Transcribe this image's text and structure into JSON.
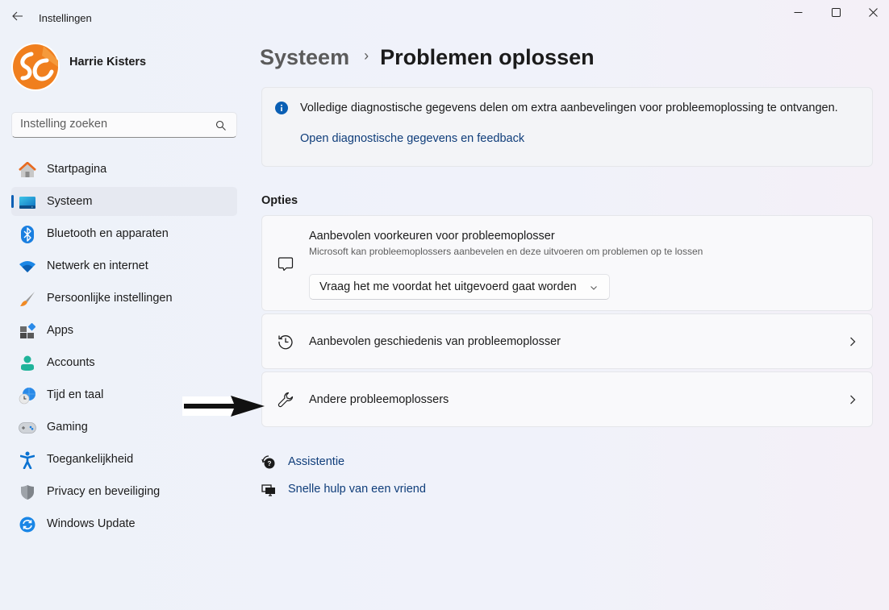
{
  "window": {
    "title": "Instellingen",
    "controls": {
      "minimize": "minimize",
      "maximize": "maximize",
      "close": "close"
    }
  },
  "profile": {
    "name": "Harrie Kisters"
  },
  "search": {
    "placeholder": "Instelling zoeken",
    "value": ""
  },
  "sidebar": {
    "items": [
      {
        "label": "Startpagina",
        "icon": "home-icon",
        "active": false
      },
      {
        "label": "Systeem",
        "icon": "system-icon",
        "active": true
      },
      {
        "label": "Bluetooth en apparaten",
        "icon": "bluetooth-icon",
        "active": false
      },
      {
        "label": "Netwerk en internet",
        "icon": "wifi-icon",
        "active": false
      },
      {
        "label": "Persoonlijke instellingen",
        "icon": "brush-icon",
        "active": false
      },
      {
        "label": "Apps",
        "icon": "apps-icon",
        "active": false
      },
      {
        "label": "Accounts",
        "icon": "account-icon",
        "active": false
      },
      {
        "label": "Tijd en taal",
        "icon": "time-language-icon",
        "active": false
      },
      {
        "label": "Gaming",
        "icon": "gamepad-icon",
        "active": false
      },
      {
        "label": "Toegankelijkheid",
        "icon": "accessibility-icon",
        "active": false
      },
      {
        "label": "Privacy en beveiliging",
        "icon": "shield-icon",
        "active": false
      },
      {
        "label": "Windows Update",
        "icon": "update-icon",
        "active": false
      }
    ]
  },
  "header": {
    "breadcrumb_parent": "Systeem",
    "breadcrumb_separator": "›",
    "title": "Problemen oplossen"
  },
  "info": {
    "text": "Volledige diagnostische gegevens delen om extra aanbevelingen voor probleemoplossing te ontvangen.",
    "link": "Open diagnostische gegevens en feedback"
  },
  "options": {
    "section_title": "Opties",
    "preferences": {
      "title": "Aanbevolen voorkeuren voor probleemoplosser",
      "description": "Microsoft kan probleemoplossers aanbevelen en deze uitvoeren om problemen op te lossen",
      "dropdown_value": "Vraag het me voordat het uitgevoerd gaat worden"
    },
    "history": {
      "title": "Aanbevolen geschiedenis van probleemoplosser"
    },
    "other": {
      "title": "Andere probleemoplossers"
    }
  },
  "help": {
    "links": [
      {
        "label": "Assistentie",
        "icon": "help-chat-icon"
      },
      {
        "label": "Snelle hulp van een vriend",
        "icon": "remote-desktop-icon"
      }
    ]
  },
  "colors": {
    "accent": "#0a5fb4",
    "link": "#0f3d7a",
    "avatar_orange": "#f07f1e"
  }
}
